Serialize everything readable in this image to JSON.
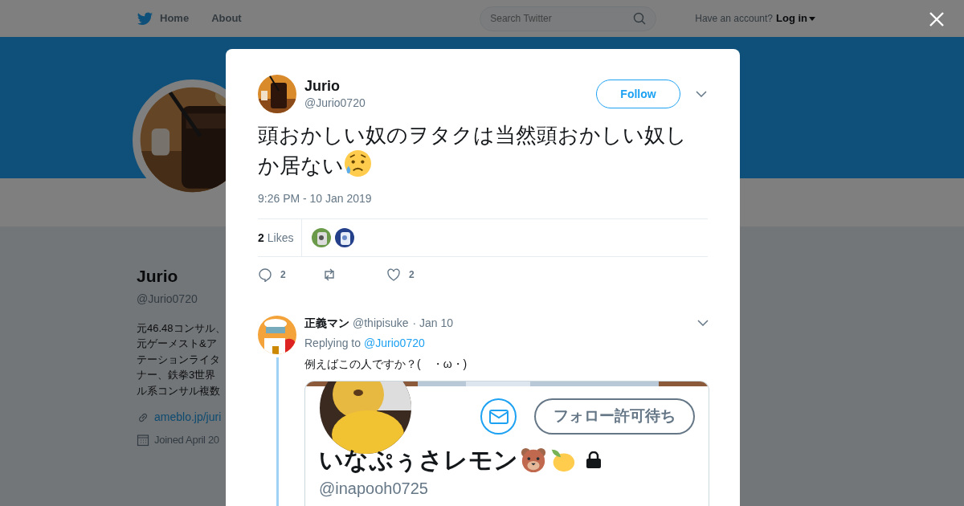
{
  "nav": {
    "items": [
      {
        "label": "Home"
      },
      {
        "label": "About"
      }
    ],
    "search": {
      "placeholder": "Search Twitter"
    },
    "account_prompt": "Have an account?",
    "login": "Log in"
  },
  "profile": {
    "name": "Jurio",
    "handle": "@Jurio0720",
    "bio_lines": [
      "元46.48コンサル、",
      "元ゲーメスト&ア",
      "テーションライタ",
      "ナー、鉄拳3世界",
      "ル系コンサル複数"
    ],
    "link": "ameblo.jp/juri",
    "joined": "Joined April 20"
  },
  "tweet": {
    "name": "Jurio",
    "handle": "@Jurio0720",
    "follow": "Follow",
    "text": "頭おかしい奴のヲタクは当然頭おかしい奴しか居ない",
    "time": "9:26 PM - 10 Jan 2019",
    "likes_count": "2",
    "likes_label": "Likes",
    "replies": "2",
    "favorites": "2"
  },
  "reply": {
    "name": "正義マン",
    "handle": "@thipisuke",
    "date": "· Jan 10",
    "replying_to": "Replying to",
    "mention": "@Jurio0720",
    "text": "例えばこの人ですか？(　・ω・)",
    "embed": {
      "button": "フォロー許可待ち",
      "name": "いなぷぅさレモン",
      "handle": "@inapooh0725"
    }
  }
}
